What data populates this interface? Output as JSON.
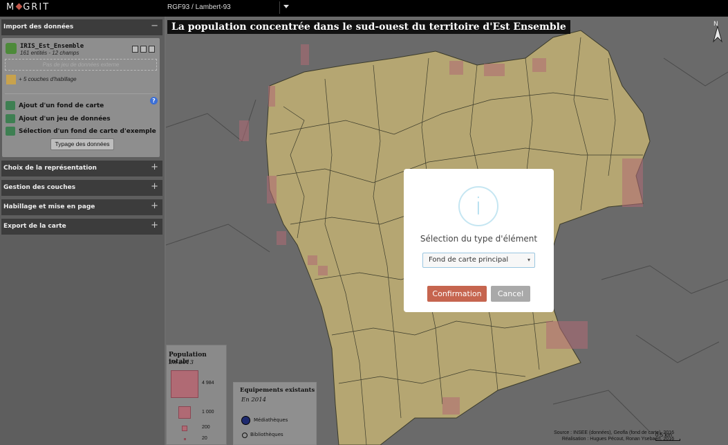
{
  "header": {
    "logo_left": "M",
    "logo_right": "GRIT",
    "projection": "RGF93 / Lambert-93"
  },
  "sidebar": {
    "sections": [
      {
        "label": "Import des données",
        "toggle": "−"
      },
      {
        "label": "Choix de la représentation",
        "toggle": "+"
      },
      {
        "label": "Gestion des couches",
        "toggle": "+"
      },
      {
        "label": "Habillage et mise en page",
        "toggle": "+"
      },
      {
        "label": "Export de la carte",
        "toggle": "+"
      }
    ],
    "layer": {
      "name": "IRIS_Est_Ensemble",
      "info": "161 entités - 12 champs"
    },
    "no_external": "Pas de jeu de données externe",
    "habillage": "+ 5 couches d'habillage",
    "actions": [
      {
        "label": "Ajout d'un fond de carte",
        "icon": "add-basemap-icon"
      },
      {
        "label": "Ajout d'un jeu de données",
        "icon": "add-dataset-icon"
      },
      {
        "label": "Sélection d'un fond de carte d'exemple",
        "icon": "example-basemap-icon"
      }
    ],
    "help": "?",
    "typage_button": "Typage des données"
  },
  "map": {
    "title": "La population concentrée dans le sud-ouest du territoire d'Est Ensemble",
    "north": "N",
    "source_line1": "Source : INSEE (données), Geofla (fond de carte), 2016",
    "source_line2": "Réalisation : Hugues Pécout, Ronan Ysebaert, 2016",
    "scale_label": "0.5 km",
    "colors": {
      "fill": "#b5a672",
      "stroke": "#3a3a2a",
      "symbol": "#b06a74"
    }
  },
  "legend_population": {
    "title": "Population totale",
    "subtitle": "En 2013",
    "values": [
      "4 984",
      "1 000",
      "200",
      "20"
    ]
  },
  "legend_equipements": {
    "title": "Equipements existants",
    "subtitle": "En 2014",
    "items": [
      "Médiathèques",
      "Bibliothèques"
    ]
  },
  "modal": {
    "title": "Sélection du type d'élément",
    "selected": "Fond de carte principal",
    "confirm": "Confirmation",
    "cancel": "Cancel",
    "icon": "i"
  }
}
